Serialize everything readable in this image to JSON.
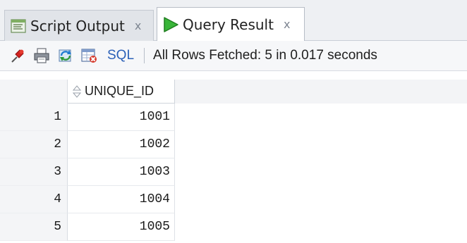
{
  "tabs": [
    {
      "label": "Script Output",
      "close": "x",
      "active": false,
      "icon": "script-output-icon"
    },
    {
      "label": "Query Result",
      "close": "x",
      "active": true,
      "icon": "run-play-icon"
    }
  ],
  "toolbar": {
    "buttons": [
      "pin-icon",
      "print-icon",
      "refresh-icon",
      "export-icon"
    ],
    "sql_label": "SQL",
    "status": "All Rows Fetched: 5 in 0.017 seconds"
  },
  "grid": {
    "columns": [
      "UNIQUE_ID"
    ],
    "rows": [
      {
        "num": "1",
        "unique_id": "1001"
      },
      {
        "num": "2",
        "unique_id": "1002"
      },
      {
        "num": "3",
        "unique_id": "1003"
      },
      {
        "num": "4",
        "unique_id": "1004"
      },
      {
        "num": "5",
        "unique_id": "1005"
      }
    ]
  },
  "colors": {
    "play_green": "#2ea82e",
    "sql_blue": "#2c61b8"
  }
}
